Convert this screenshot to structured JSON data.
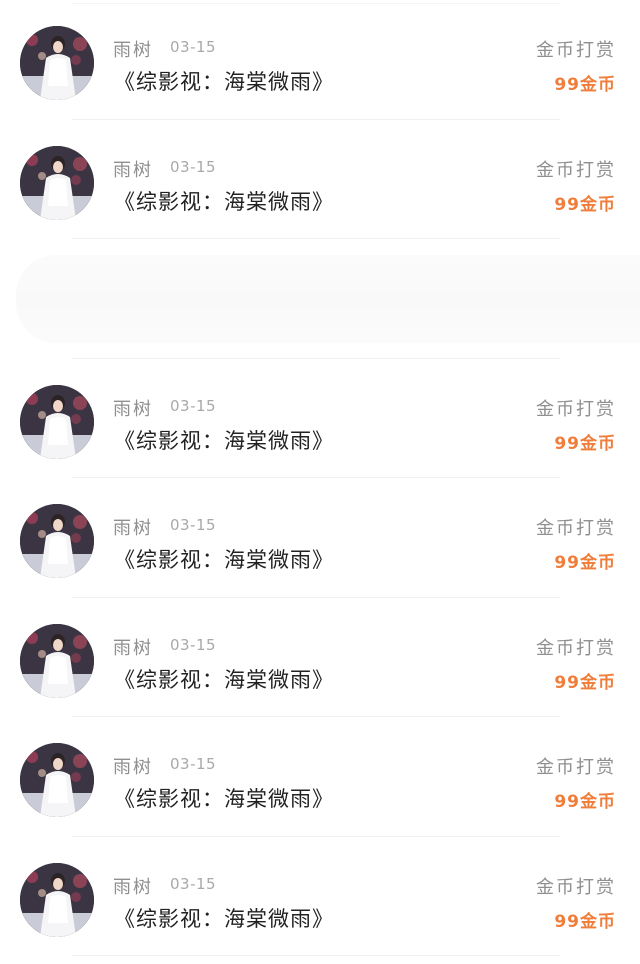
{
  "records": [
    {
      "user": "雨树",
      "date": "03-15",
      "book": "《综影视：海棠微雨》",
      "action": "金币打赏",
      "amount": "99金币"
    },
    {
      "user": "雨树",
      "date": "03-15",
      "book": "《综影视：海棠微雨》",
      "action": "金币打赏",
      "amount": "99金币"
    },
    {
      "blank": true
    },
    {
      "user": "雨树",
      "date": "03-15",
      "book": "《综影视：海棠微雨》",
      "action": "金币打赏",
      "amount": "99金币"
    },
    {
      "user": "雨树",
      "date": "03-15",
      "book": "《综影视：海棠微雨》",
      "action": "金币打赏",
      "amount": "99金币"
    },
    {
      "user": "雨树",
      "date": "03-15",
      "book": "《综影视：海棠微雨》",
      "action": "金币打赏",
      "amount": "99金币"
    },
    {
      "user": "雨树",
      "date": "03-15",
      "book": "《综影视：海棠微雨》",
      "action": "金币打赏",
      "amount": "99金币"
    },
    {
      "user": "雨树",
      "date": "03-15",
      "book": "《综影视：海棠微雨》",
      "action": "金币打赏",
      "amount": "99金币"
    }
  ],
  "colors": {
    "name": "#8f8f8f",
    "date": "#a9a9a9",
    "title": "#222222",
    "amount": "#f07d3a"
  },
  "avatar_icon": "user-avatar-photo"
}
